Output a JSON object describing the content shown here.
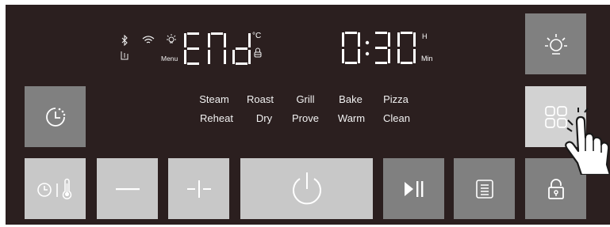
{
  "display": {
    "left_digits": "End",
    "temp_unit": "°C",
    "menu_label": "Menu",
    "time_digits": "0:30",
    "hours_unit": "H",
    "minutes_unit": "Min"
  },
  "status_icons": [
    "bluetooth-icon",
    "wifi-icon",
    "lamp-icon",
    "water-tank-icon",
    "lock-icon"
  ],
  "programs": {
    "row1": [
      "Steam",
      "Roast",
      "Grill",
      "Bake",
      "Pizza"
    ],
    "row2": [
      "Reheat",
      "Dry",
      "Prove",
      "Warm",
      "Clean"
    ]
  },
  "buttons": {
    "light": "lamp-icon",
    "timer": "clock-icon",
    "programs_menu": "grid-icon",
    "time_temp": "clock-thermometer-icon",
    "minus": "minus-icon",
    "plus": "plus-icon",
    "power": "power-icon",
    "start_pause": "play-pause-icon",
    "recipes": "list-icon",
    "child_lock": "padlock-icon"
  },
  "colors": {
    "panel": "#2b1f1f",
    "button_dark": "#808080",
    "button_medium": "#a0a0a0",
    "button_light": "#c8c8c8",
    "button_highlight": "#d2d2d2",
    "segment": "#ffffff"
  }
}
